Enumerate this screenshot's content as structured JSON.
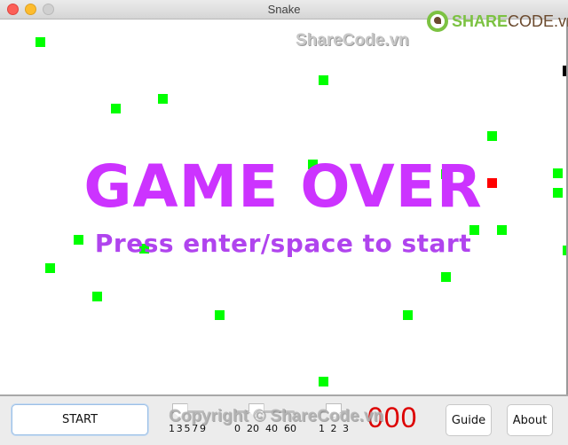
{
  "window": {
    "title": "Snake"
  },
  "watermark": {
    "text": "ShareCode.vn",
    "logo_share": "SHARE",
    "logo_code": "CODE.vn",
    "copyright": "Copyright © ShareCode.vn"
  },
  "game": {
    "state": "game_over",
    "title": "GAME OVER",
    "prompt": "Press enter/space to start",
    "colors": {
      "food": "#00ff00",
      "snake_head": "#ff0000",
      "snake_body": "#000000",
      "text": "#cc33ff"
    },
    "food_count": 20
  },
  "controls": {
    "start_label": "START",
    "sliders": [
      {
        "name": "speed",
        "min": 1,
        "max": 9,
        "value": 3,
        "labels": [
          "1",
          "3",
          "5",
          "7",
          "9"
        ]
      },
      {
        "name": "food",
        "min": 0,
        "max": 60,
        "value": 20,
        "labels": [
          "0",
          "20",
          "40",
          "60"
        ]
      },
      {
        "name": "level",
        "min": 1,
        "max": 3,
        "value": 2,
        "labels": [
          "1",
          "2",
          "3"
        ]
      }
    ],
    "score": "000",
    "guide_label": "Guide",
    "about_label": "About"
  }
}
